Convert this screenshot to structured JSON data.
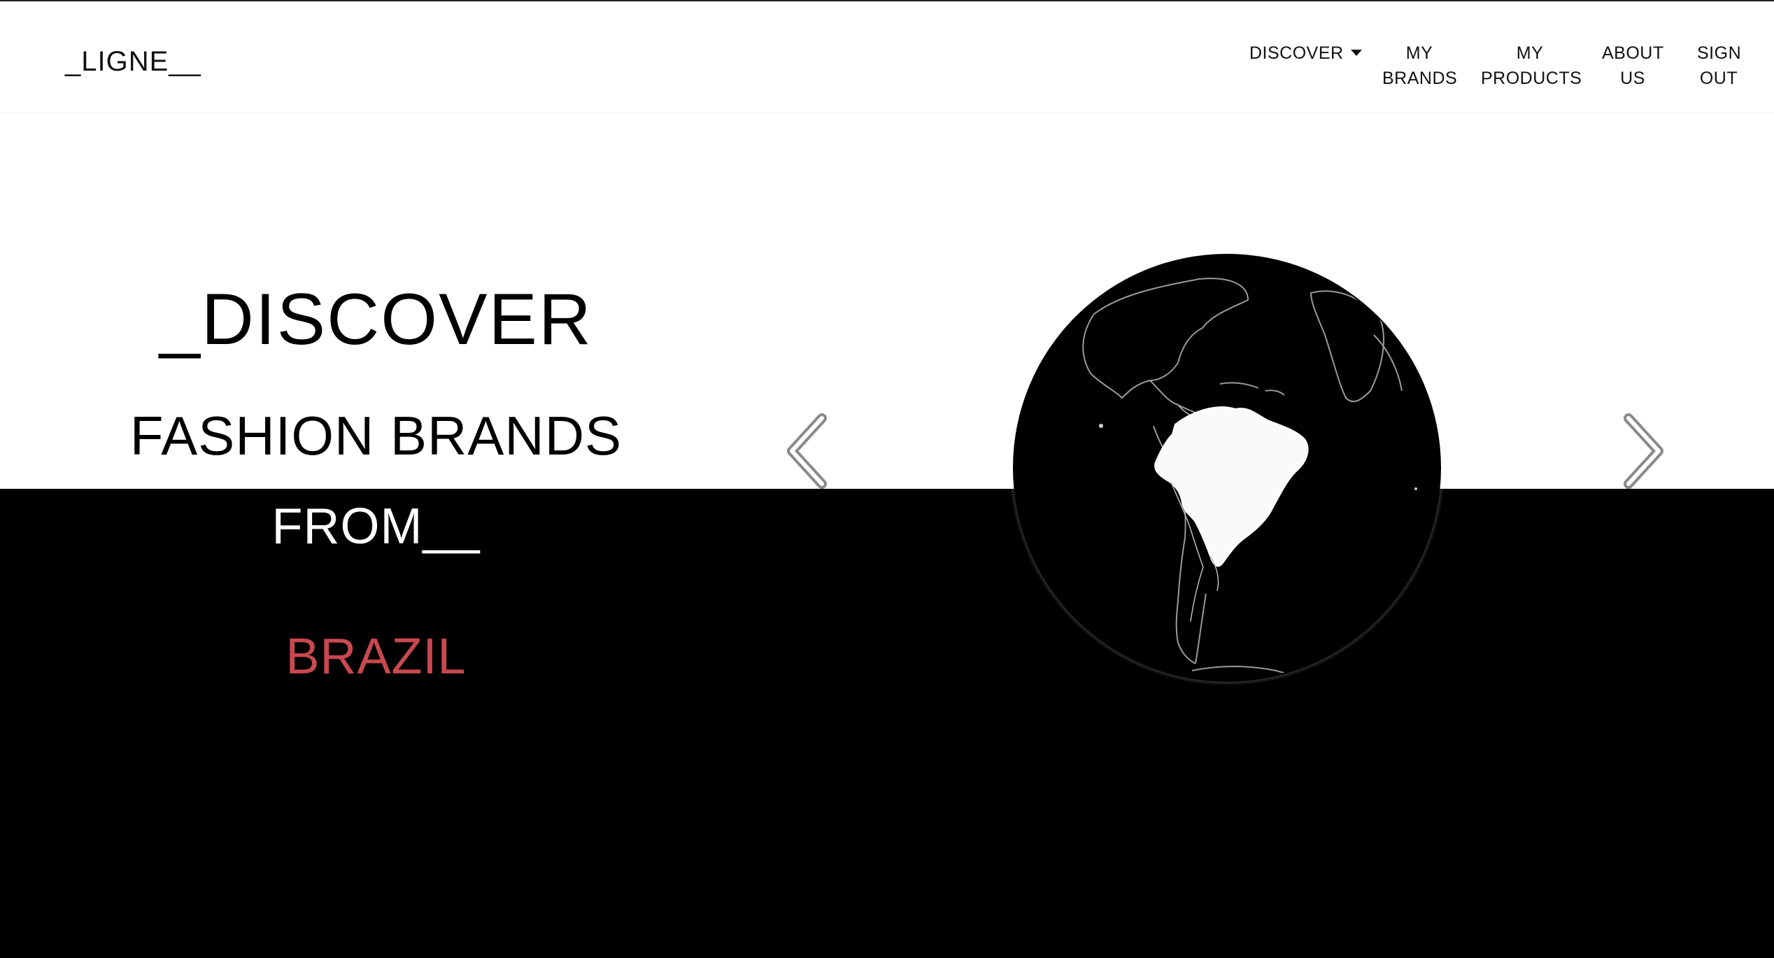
{
  "navbar": {
    "brand": "_LIGNE__",
    "discover_label": "DISCOVER",
    "my_brands_line1": "MY",
    "my_brands_line2": "BRANDS",
    "my_products_line1": "MY",
    "my_products_line2": "PRODUCTS",
    "about_us_line1": "ABOUT",
    "about_us_line2": "US",
    "sign_out_line1": "SIGN",
    "sign_out_line2": "OUT"
  },
  "hero": {
    "discover": "_DISCOVER",
    "fashion_brands": "FASHION BRANDS",
    "from": "FROM__",
    "country": "BRAZIL"
  },
  "icons": {
    "prev": "chevron-left-icon",
    "next": "chevron-right-icon",
    "caret": "caret-down-icon",
    "globe": "globe-image"
  },
  "colors": {
    "accent": "#c9484f",
    "background_top": "#ffffff",
    "background_bottom": "#000000"
  }
}
